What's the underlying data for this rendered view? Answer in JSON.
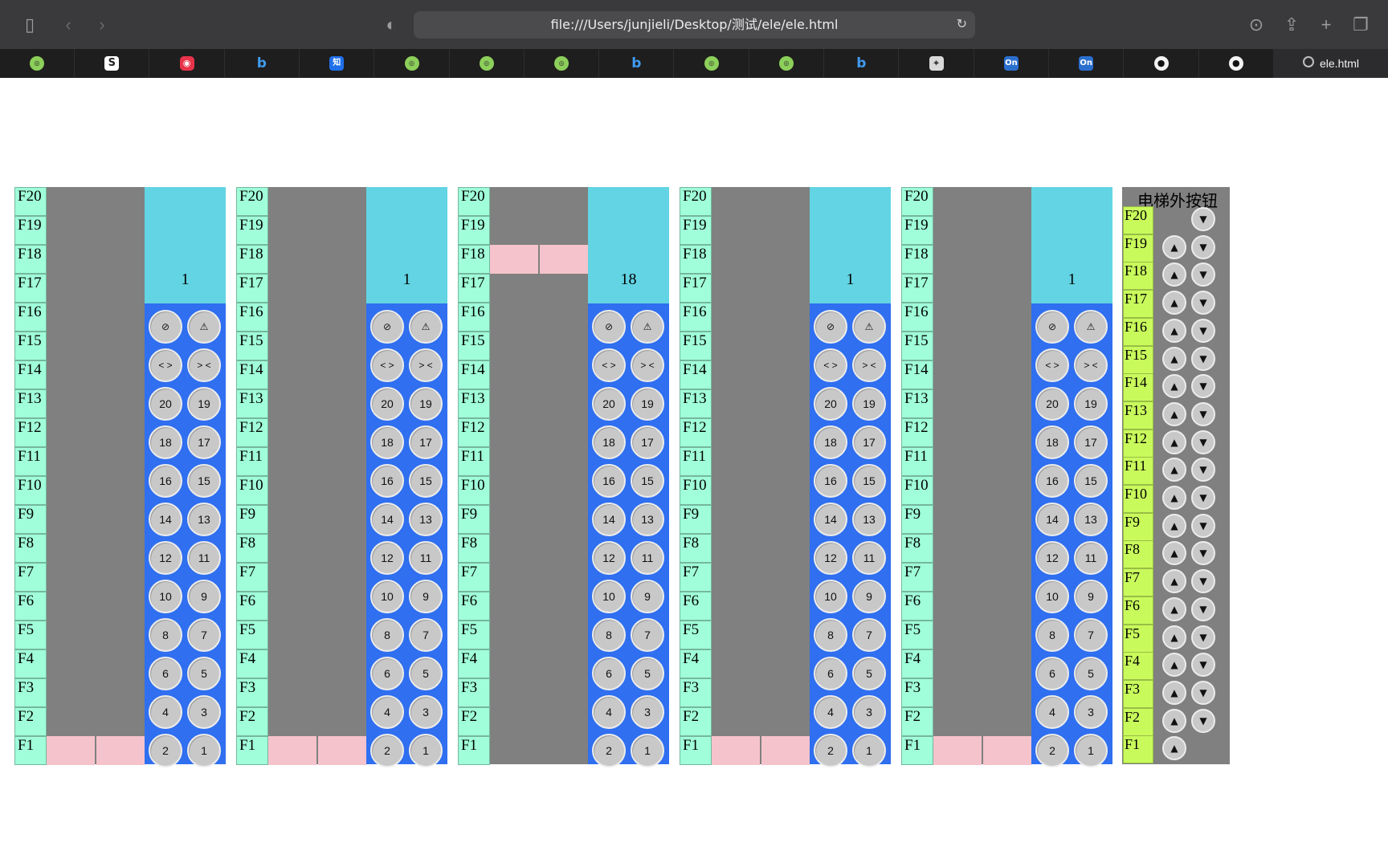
{
  "browser": {
    "url": "file:///Users/junjieli/Desktop/测试/ele/ele.html",
    "active_tab_label": "ele.html",
    "tab_favicons": [
      "green-badge",
      "S",
      "red-camera",
      "bing-b",
      "知",
      "green-badge",
      "green-badge",
      "green-badge",
      "bing-b",
      "green-badge",
      "green-badge",
      "bing-b",
      "map",
      "On",
      "On",
      "github",
      "github"
    ]
  },
  "floors": [
    "F20",
    "F19",
    "F18",
    "F17",
    "F16",
    "F15",
    "F14",
    "F13",
    "F12",
    "F11",
    "F10",
    "F9",
    "F8",
    "F7",
    "F6",
    "F5",
    "F4",
    "F3",
    "F2",
    "F1"
  ],
  "elevators": [
    {
      "display": "1",
      "current_floor": 1
    },
    {
      "display": "1",
      "current_floor": 1
    },
    {
      "display": "18",
      "current_floor": 18
    },
    {
      "display": "1",
      "current_floor": 1
    },
    {
      "display": "1",
      "current_floor": 1
    }
  ],
  "keypad": [
    [
      "⊘",
      "⚠"
    ],
    [
      "< >",
      "> <"
    ],
    [
      "20",
      "19"
    ],
    [
      "18",
      "17"
    ],
    [
      "16",
      "15"
    ],
    [
      "14",
      "13"
    ],
    [
      "12",
      "11"
    ],
    [
      "10",
      "9"
    ],
    [
      "8",
      "7"
    ],
    [
      "6",
      "5"
    ],
    [
      "4",
      "3"
    ],
    [
      "2",
      "1"
    ]
  ],
  "outer_panel": {
    "title": "电梯外按钮",
    "up_symbol": "▲",
    "down_symbol": "▼"
  },
  "colors": {
    "floor_label_bg": "#a0ffda",
    "shaft_bg": "#808080",
    "door_bg": "#f5c3cb",
    "display_bg": "#62d4e3",
    "keypad_bg": "#2f6ff0",
    "outer_floor_bg": "#c9fa5c"
  }
}
